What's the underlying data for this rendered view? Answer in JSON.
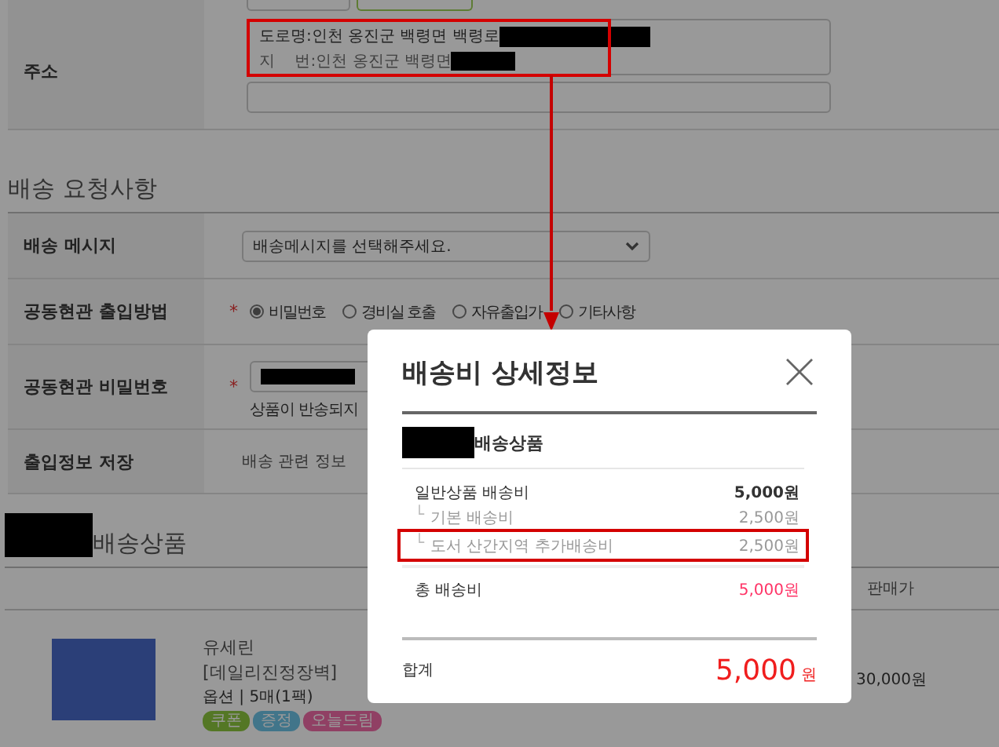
{
  "address": {
    "label": "주소",
    "highlighted": true,
    "lines": [
      {
        "kind": "road",
        "label": "도로명",
        "value": ":인천 옹진군 백령면 백령로"
      },
      {
        "kind": "lot",
        "label": "지    번",
        "value": ":인천 옹진군 백령면"
      }
    ]
  },
  "delivery_request": {
    "title": "배송 요청사항",
    "rows": [
      {
        "kind": "select",
        "label": "배송 메시지",
        "value": "배송메시지를 선택해주세요."
      },
      {
        "kind": "radio",
        "label": "공동현관 출입방법",
        "mark": "*",
        "options": [
          {
            "label": "비밀번호",
            "selected": true
          },
          {
            "label": "경비실 호출",
            "selected": false
          },
          {
            "label": "자유출입가",
            "selected": false
          },
          {
            "label": "기타사항",
            "selected": false
          }
        ]
      },
      {
        "kind": "password",
        "label": "공동현관 비밀번호",
        "mark": "*",
        "hint": "상품이 반송되지"
      },
      {
        "kind": "text",
        "label": "출입정보 저장",
        "value": "배송 관련 정보"
      }
    ]
  },
  "products": {
    "title": "배송상품",
    "columns": [
      "판매가"
    ],
    "items": [
      {
        "brand": "유세린",
        "name": "[데일리진정장벽]",
        "option": "옵션 | 5매(1팩)",
        "price": "30,000원",
        "tags": [
          {
            "label": "쿠폰",
            "color": "#547725"
          },
          {
            "label": "증정",
            "color": "#41758a"
          },
          {
            "label": "오늘드림",
            "color": "#904064"
          }
        ]
      }
    ]
  },
  "modal": {
    "title": "배송비 상세정보",
    "group_title": "배송상품",
    "rows": [
      {
        "kind": "main",
        "label": "일반상품 배송비",
        "amount": "5,000원",
        "highlighted": false
      },
      {
        "kind": "sub",
        "prefix": "└",
        "label": "기본 배송비",
        "amount": "2,500원",
        "highlighted": false
      },
      {
        "kind": "sub",
        "prefix": "└",
        "label": "도서 산간지역 추가배송비",
        "amount": "2,500원",
        "highlighted": true
      }
    ],
    "total": {
      "label": "총 배송비",
      "amount": "5,000원"
    },
    "sum": {
      "label": "합계",
      "amount": "5,000",
      "unit": "원"
    }
  }
}
